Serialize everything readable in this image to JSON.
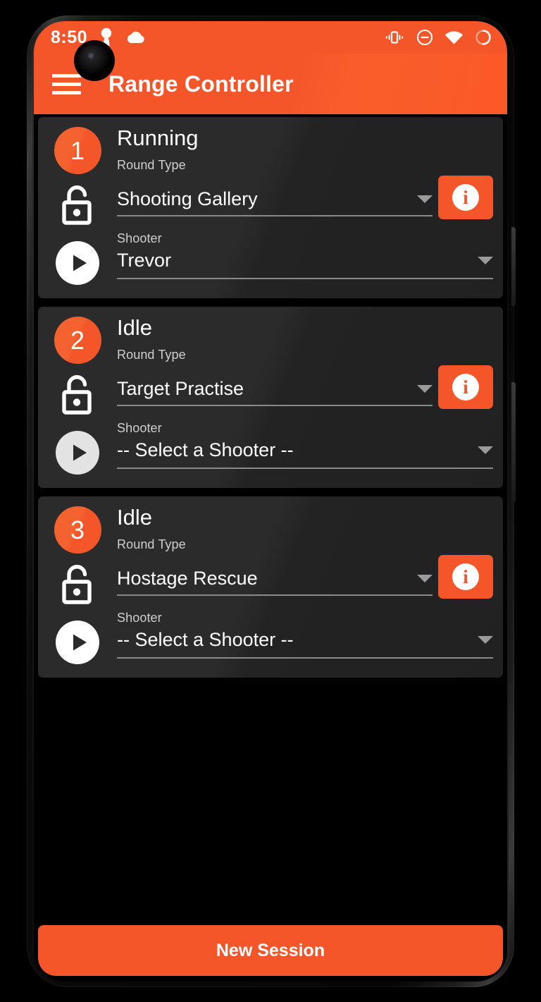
{
  "statusbar": {
    "time": "8:50",
    "left_icons": [
      "keyhole-icon",
      "cloud-icon"
    ],
    "right_icons": [
      "vibrate-icon",
      "do-not-disturb-icon",
      "wifi-icon",
      "battery-icon"
    ]
  },
  "appbar": {
    "title": "Range Controller",
    "menu_icon": "hamburger-menu-icon"
  },
  "theme": {
    "accent": "#F4562A",
    "card_bg": "#2B2B2B",
    "screen_bg": "#000000",
    "text_primary": "#FFFFFF",
    "text_secondary": "#CFCFCF",
    "divider": "#8A8A8A"
  },
  "labels": {
    "round_type": "Round Type",
    "shooter": "Shooter",
    "info": "i"
  },
  "lanes": [
    {
      "number": "1",
      "status": "Running",
      "round_type_label": "Round Type",
      "round_type_value": "Shooting Gallery",
      "shooter_label": "Shooter",
      "shooter_value": "Trevor",
      "lock_icon": "unlocked-padlock-icon",
      "play_icon": "play-circle-icon",
      "info_label": "i"
    },
    {
      "number": "2",
      "status": "Idle",
      "round_type_label": "Round Type",
      "round_type_value": "Target Practise",
      "shooter_label": "Shooter",
      "shooter_value": "-- Select a Shooter --",
      "lock_icon": "unlocked-padlock-icon",
      "play_icon": "play-circle-icon",
      "info_label": "i"
    },
    {
      "number": "3",
      "status": "Idle",
      "round_type_label": "Round Type",
      "round_type_value": "Hostage Rescue",
      "shooter_label": "Shooter",
      "shooter_value": "-- Select a Shooter --",
      "lock_icon": "unlocked-padlock-icon",
      "play_icon": "play-circle-icon",
      "info_label": "i"
    }
  ],
  "footer": {
    "new_session_label": "New Session"
  }
}
